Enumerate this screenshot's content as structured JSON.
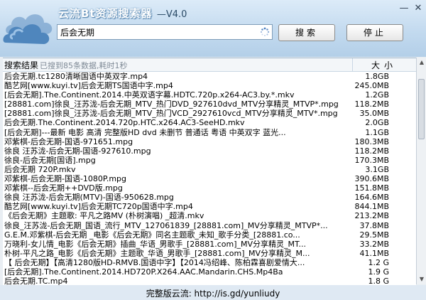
{
  "app": {
    "title": "云流Bt资源搜索器",
    "version": "—V4.0",
    "min_glyph": "—",
    "close_glyph": "✕"
  },
  "search": {
    "value": "后会无期",
    "button_label": "搜索",
    "stop_label": "停止"
  },
  "results": {
    "header_label": "搜索结果",
    "status": "已搜到85条数据,耗时1秒",
    "size_header": "大小",
    "rows": [
      {
        "name": "后会无期.tc1280清晰国语中英双字.mp4",
        "size": "1.8GB"
      },
      {
        "name": "酷艺网[www.kuyi.tv]后会无期TS国语中字.mp4",
        "size": "245.0MB"
      },
      {
        "name": "[后会无期].The.Continent.2014.中英双语字幕.HDTC.720p.x264-AC3.by.*.mkv",
        "size": "1.2GB"
      },
      {
        "name": "[28881.com]徐良_汪苏泷-后会无期_MTV_热门DVD_927610dvd_MTV分享精灵_MTVP*.mpg",
        "size": "118.2MB"
      },
      {
        "name": "[28881.com]徐良_汪苏泷-后会无期_MTV_热门VCD_2927610vcd_MTV分享精灵_MTV*.mpg",
        "size": "35.0MB"
      },
      {
        "name": "后会无期.The.Continent.2014.720p.HTC.x264.AC3-SeeHD.mkv",
        "size": "2.0GB"
      },
      {
        "name": "[后会无期]---最新 电影 高清 完整版HD dvd 未删节 普通话 粤语 中英双字 蓝光...",
        "size": "1.1GB"
      },
      {
        "name": "邓紫棋-后会无期-国语-971651.mpg",
        "size": "180.3MB"
      },
      {
        "name": "徐良 汪苏泷-后会无期-国语-927610.mpg",
        "size": "118.2MB"
      },
      {
        "name": "徐良-后会无期[国语].mpg",
        "size": "170.3MB"
      },
      {
        "name": "后会无期 720P.mkv",
        "size": "3.1GB"
      },
      {
        "name": "邓紫棋-后会无期-国语-1080P.mpg",
        "size": "390.6MB"
      },
      {
        "name": "邓紫棋--后会无期++DVD版.mpg",
        "size": "151.8MB"
      },
      {
        "name": "徐良 汪苏泷-后会无期(MTV)-国语-950628.mpg",
        "size": "164.6MB"
      },
      {
        "name": "酷艺网[www.kuyi.tv]后会无期TC720p国语中字.mp4",
        "size": "844.1MB"
      },
      {
        "name": "《后会无期》主题歌: 平凡之路MV (朴树演唱) _超清.mkv",
        "size": "213.2MB"
      },
      {
        "name": "徐良_汪苏泷-后会无期_国语_流行_MTV_127061839_[28881.com]_MV分享精灵_MTVP*...",
        "size": "37.8MB"
      },
      {
        "name": "G.E.M.邓紫棋-后会无期 _电影《后会无期》同名主题歌_未知_歌手分类_[28881.co...",
        "size": "29.5MB"
      },
      {
        "name": "万晓利-女儿情_电影《后会无期》插曲_华语_男歌手_[28881.com]_MV分享精灵_MT...",
        "size": "33.2MB"
      },
      {
        "name": "朴树-平凡之路_电影《后会无期》主题歌_华语_男歌手_[28881.com]_MV分享精灵_M...",
        "size": "41.1MB"
      },
      {
        "name": "【 后会无期】【高清1280版HD-RMVB.国语中字】【2014冯绍峰、陈柏霖喜剧爱情大...",
        "size": "1.2 G"
      },
      {
        "name": "[后会无期].The.Continent.2014.HD720P.X264.AAC.Mandarin.CHS.Mp4Ba",
        "size": "1.9 G"
      },
      {
        "name": "后会无期.TC.mp4",
        "size": "1.8 G"
      }
    ]
  },
  "footer": {
    "text": "完整版云流: http://is.gd/yunliudy"
  },
  "colors": {
    "header_bg": "#c3daef",
    "list_bg": "#ffffff",
    "footer_bg": "#dfe9f3"
  },
  "icons": [
    "cloud-logo-icon",
    "loading-spinner-icon",
    "scroll-up-arrow-icon",
    "scroll-down-arrow-icon"
  ]
}
